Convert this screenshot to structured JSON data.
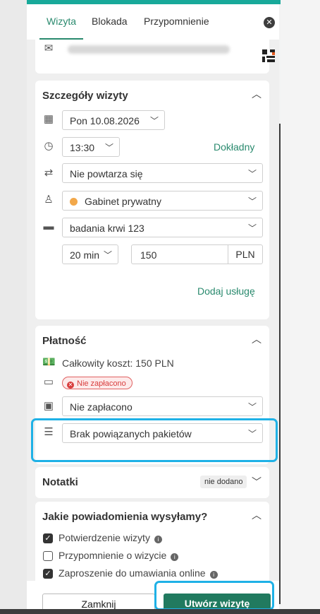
{
  "tabs": [
    {
      "label": "Wizyta",
      "active": true
    },
    {
      "label": "Blokada",
      "active": false
    },
    {
      "label": "Przypomnienie",
      "active": false
    }
  ],
  "close_icon": "close-icon",
  "visit_details": {
    "title": "Szczegóły wizyty",
    "date": "Pon 10.08.2026",
    "time": "13:30",
    "exact_link": "Dokładny",
    "repeat": "Nie powtarza się",
    "location": "Gabinet prywatny",
    "location_color": "#f2a84a",
    "service": "badania krwi 123",
    "duration": "20 min",
    "price": "150",
    "currency": "PLN",
    "add_service": "Dodaj usługę"
  },
  "payment": {
    "title": "Płatność",
    "total_cost": "Całkowity koszt: 150 PLN",
    "status_badge": "Nie zapłacono",
    "status_select": "Nie zapłacono",
    "packages_select": "Brak powiązanych pakietów"
  },
  "notes": {
    "title": "Notatki",
    "chip": "nie dodano"
  },
  "notifications": {
    "title": "Jakie powiadomienia wysyłamy?",
    "items": [
      {
        "label": "Potwierdzenie wizyty",
        "checked": true
      },
      {
        "label": "Przypomnienie o wizycie",
        "checked": false
      },
      {
        "label": "Zaproszenie do umawiania online",
        "checked": true
      }
    ]
  },
  "footer": {
    "close_label": "Zamknij",
    "create_label": "Utwórz wizytę"
  },
  "colors": {
    "accent": "#2a8a6e",
    "primary_button": "#217a5f",
    "highlight": "#1fb1e6",
    "badge_red": "#d83c3c"
  }
}
